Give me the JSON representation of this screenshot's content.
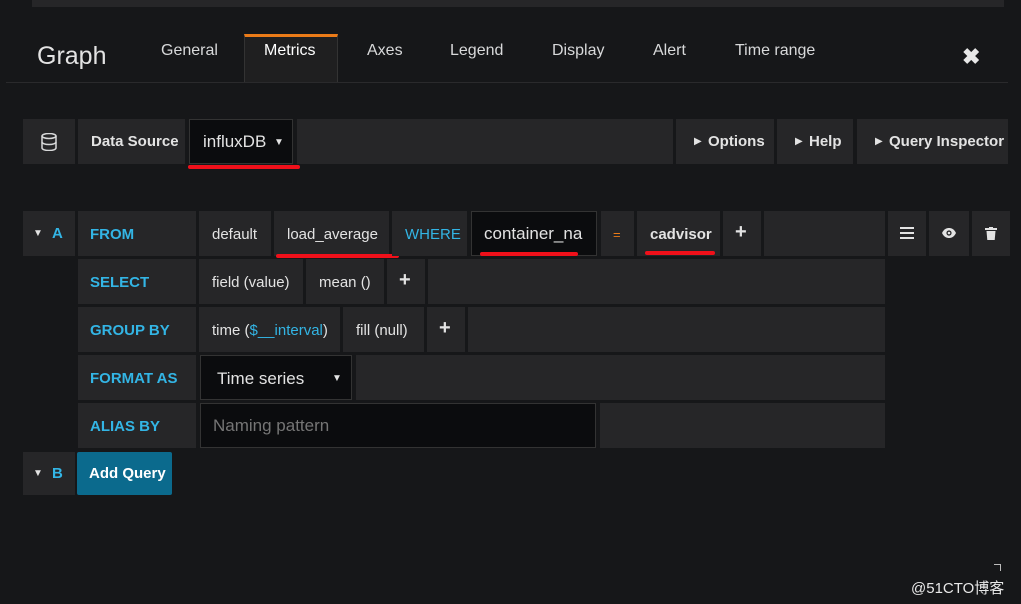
{
  "panel": {
    "title": "Graph"
  },
  "tabs": [
    "General",
    "Metrics",
    "Axes",
    "Legend",
    "Display",
    "Alert",
    "Time range"
  ],
  "datasource": {
    "label": "Data Source",
    "value": "influxDB"
  },
  "toolbar": {
    "options": "Options",
    "help": "Help",
    "inspector": "Query Inspector"
  },
  "query_a": {
    "letter": "A",
    "from": {
      "label": "FROM",
      "policy": "default",
      "measurement": "load_average",
      "where_label": "WHERE",
      "where_key": "container_na",
      "operator": "=",
      "where_value": "cadvisor"
    },
    "select": {
      "label": "SELECT",
      "field": "field (value)",
      "fn": "mean ()"
    },
    "group_by": {
      "label": "GROUP BY",
      "time_prefix": "time (",
      "time_var": "$__interval",
      "time_suffix": ")",
      "fill": "fill (null)"
    },
    "format_as": {
      "label": "FORMAT AS",
      "value": "Time series"
    },
    "alias_by": {
      "label": "ALIAS BY",
      "placeholder": "Naming pattern"
    }
  },
  "query_b": {
    "letter": "B",
    "add_button": "Add Query"
  },
  "watermark": "@51CTO博客",
  "colors": {
    "accent": "#33b5e5",
    "tab_highlight": "#eb7b18",
    "annotation": "#f0101a",
    "button_blue": "#0b6a8d"
  }
}
